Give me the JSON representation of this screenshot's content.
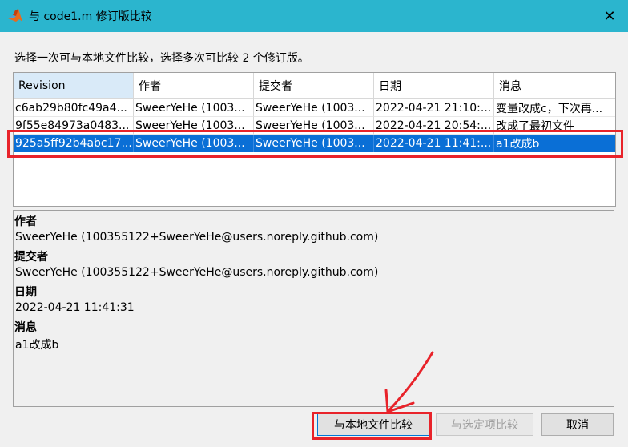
{
  "window": {
    "title": "与 code1.m 修订版比较",
    "close_glyph": "✕"
  },
  "instruction": "选择一次可与本地文件比较，选择多次可比较 2 个修订版。",
  "table": {
    "columns": [
      "Revision",
      "作者",
      "提交者",
      "日期",
      "消息"
    ],
    "sorted_column": "Revision",
    "rows": [
      [
        "c6ab29b80fc49a4...",
        "SweerYeHe (1003...",
        "SweerYeHe (1003...",
        "2022-04-21 21:10:...",
        "变量改成c，下次再..."
      ],
      [
        "9f55e84973a0483...",
        "SweerYeHe (1003...",
        "SweerYeHe (1003...",
        "2022-04-21 20:54:...",
        "改成了最初文件"
      ],
      [
        "925a5ff92b4abc17...",
        "SweerYeHe (1003...",
        "SweerYeHe (1003...",
        "2022-04-21 11:41:...",
        "a1改成b"
      ]
    ],
    "selected_row_index": 2
  },
  "details": {
    "author_label": "作者",
    "author_value": "SweerYeHe (100355122+SweerYeHe@users.noreply.github.com)",
    "committer_label": "提交者",
    "committer_value": "SweerYeHe (100355122+SweerYeHe@users.noreply.github.com)",
    "date_label": "日期",
    "date_value": "2022-04-21 11:41:31",
    "message_label": "消息",
    "message_value": "a1改成b"
  },
  "buttons": {
    "compare_local": "与本地文件比较",
    "compare_selected": "与选定项比较",
    "cancel": "取消"
  },
  "colors": {
    "titlebar": "#2bb5ce",
    "selection": "#0a6fd6",
    "annotation": "#e8232a"
  }
}
